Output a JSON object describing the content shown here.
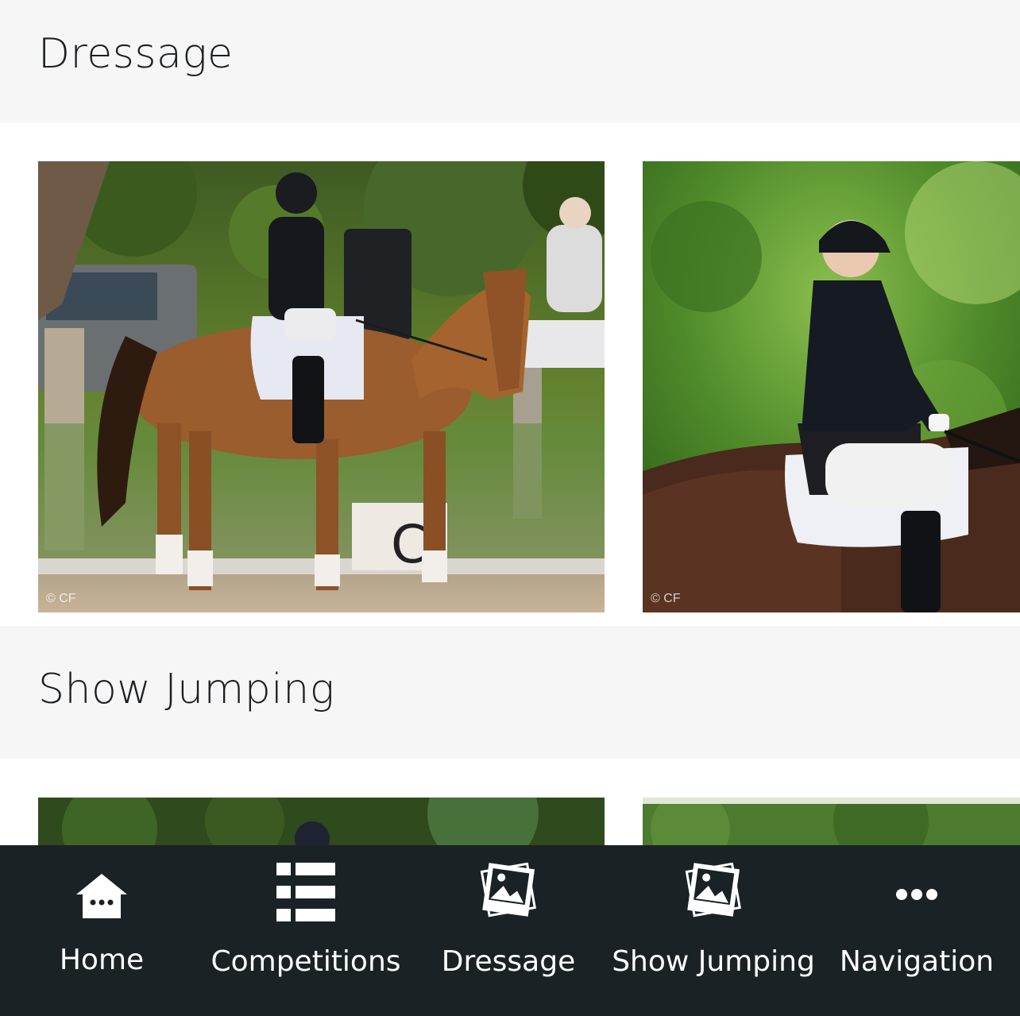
{
  "sections": {
    "dressage": {
      "title": "Dressage"
    },
    "show_jumping": {
      "title": "Show Jumping"
    }
  },
  "photos": {
    "credit": "© CF",
    "dressage_marker_letter": "C"
  },
  "nav": {
    "items": [
      {
        "label": "Home",
        "icon": "home-icon"
      },
      {
        "label": "Competitions",
        "icon": "list-icon"
      },
      {
        "label": "Dressage",
        "icon": "photo-stack-icon"
      },
      {
        "label": "Show Jumping",
        "icon": "photo-stack-icon"
      },
      {
        "label": "Navigation",
        "icon": "more-dots-icon"
      }
    ]
  },
  "colors": {
    "nav_background": "#1a2226",
    "header_background": "#f6f6f6",
    "text_dark": "#1c1f22"
  }
}
